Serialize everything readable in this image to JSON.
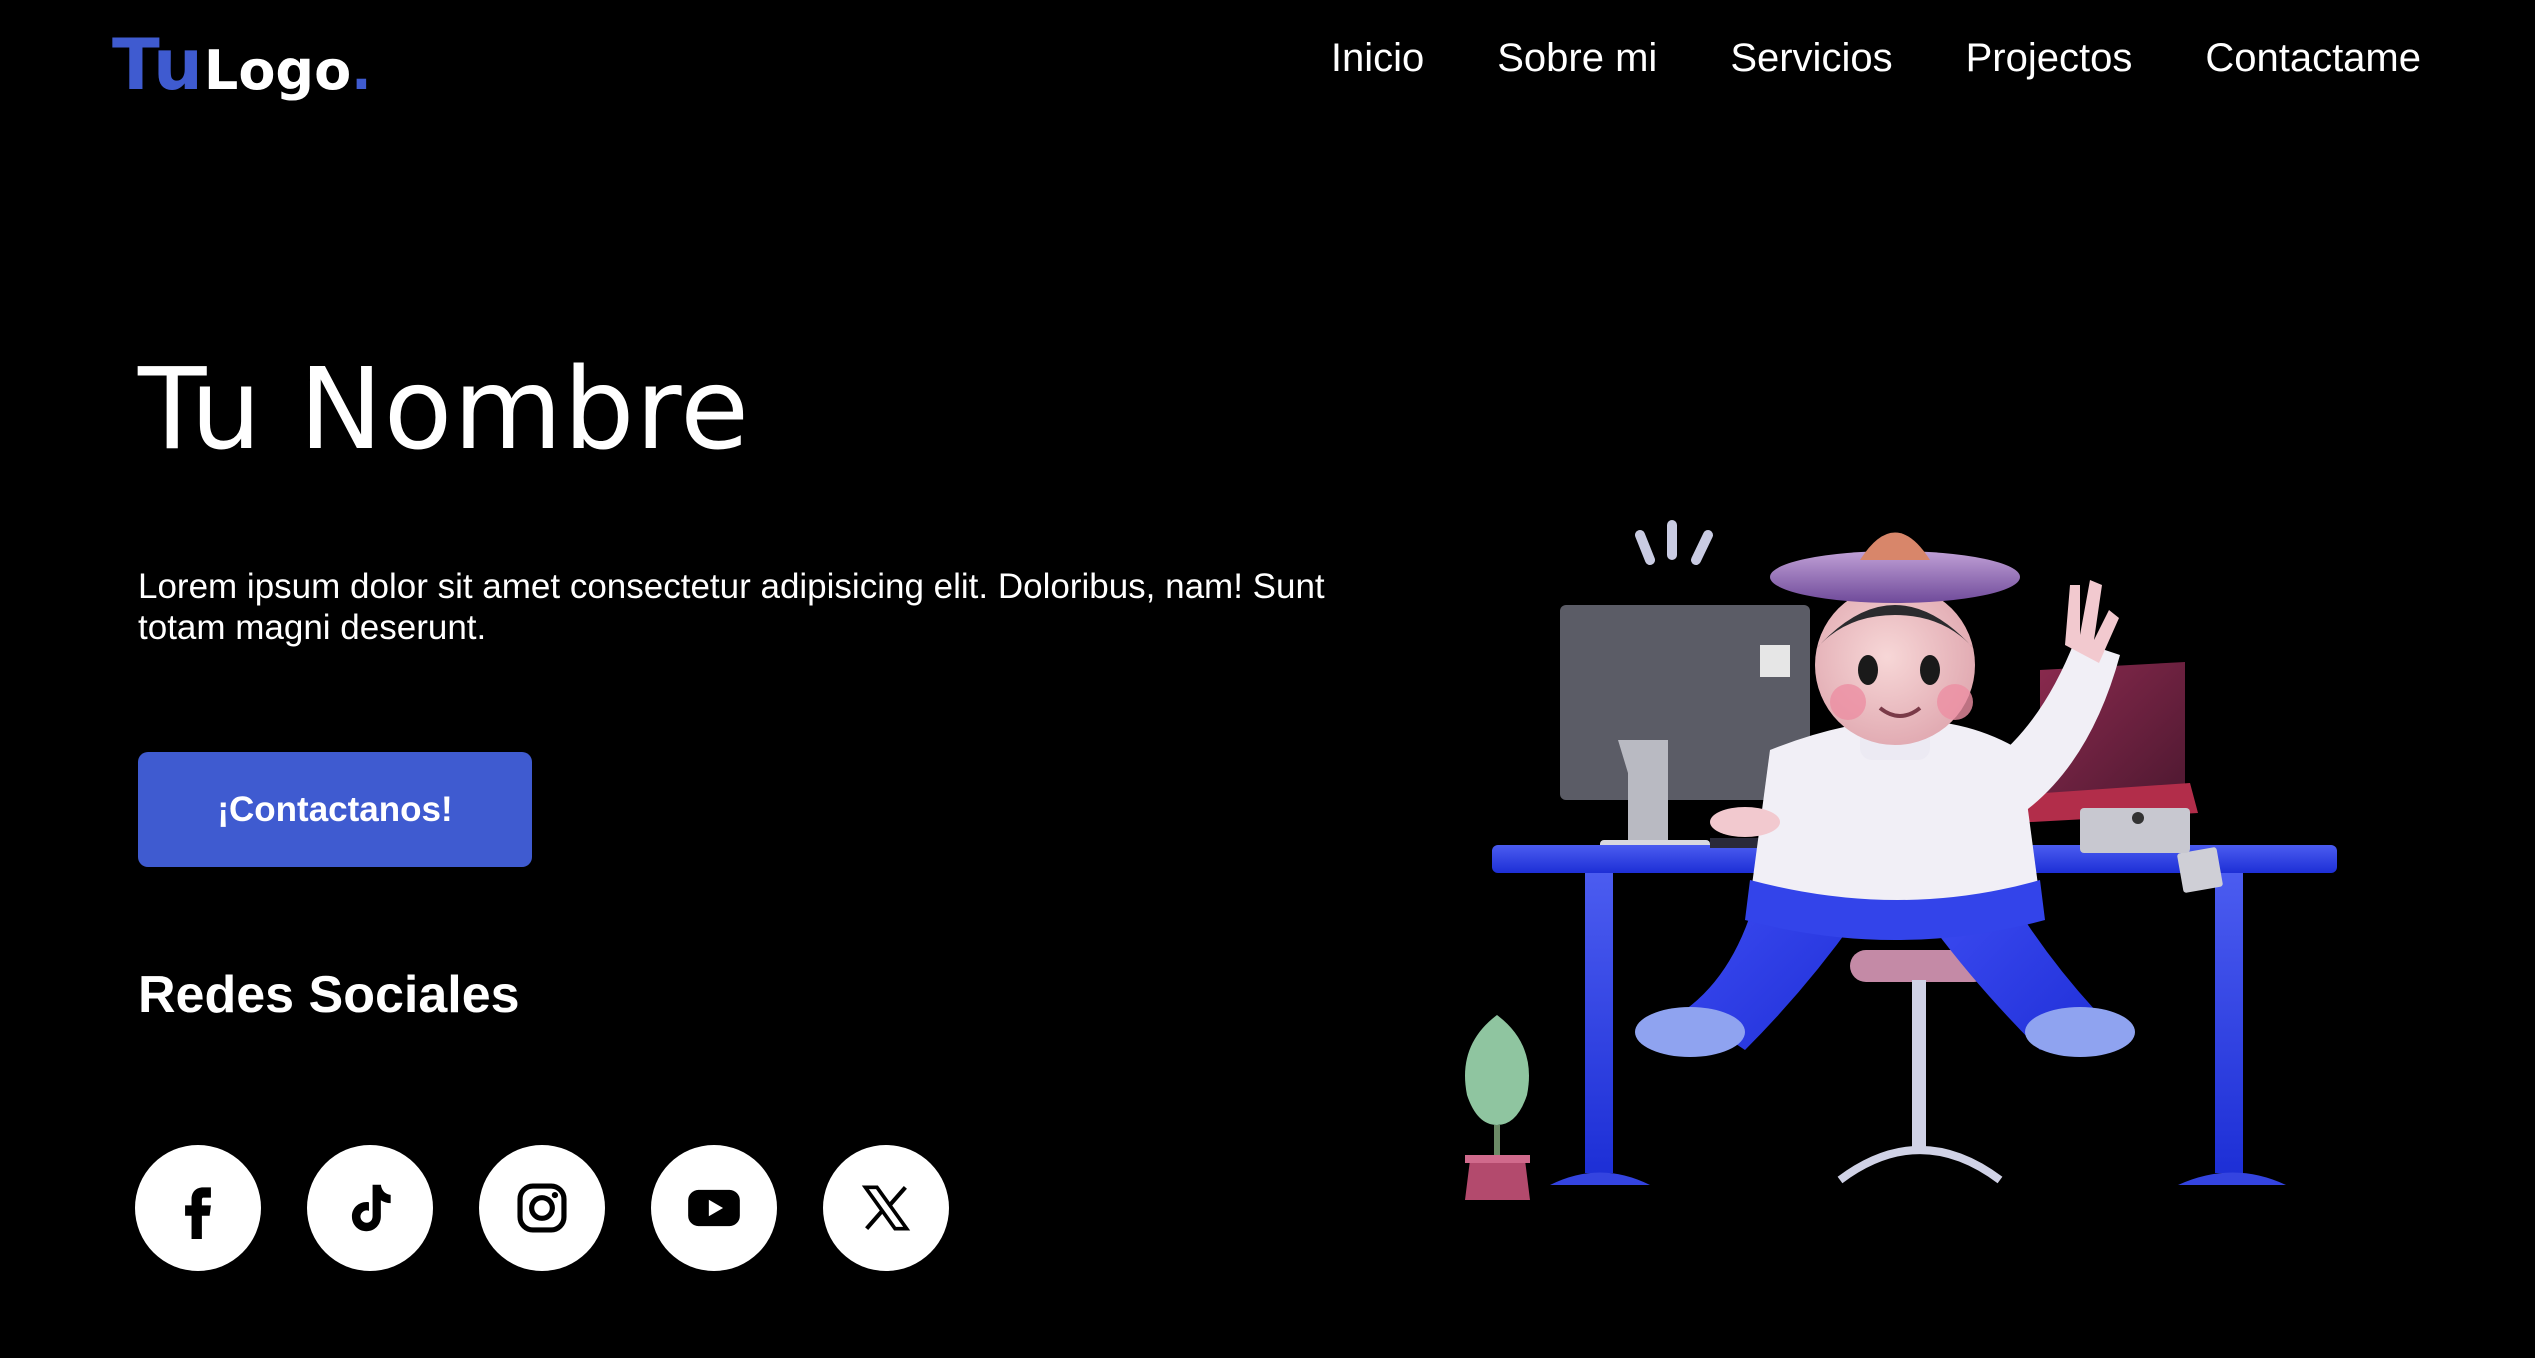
{
  "header": {
    "logo": {
      "tu": "Tu",
      "text": "Logo",
      "dot": "."
    },
    "nav": [
      "Inicio",
      "Sobre mi",
      "Servicios",
      "Projectos",
      "Contactame"
    ]
  },
  "hero": {
    "title": "Tu Nombre",
    "description": "Lorem ipsum dolor sit amet consectetur adipisicing elit. Doloribus, nam! Sunt totam magni deserunt.",
    "cta_label": "¡Contactanos!",
    "social_title": "Redes Sociales"
  },
  "socials": [
    {
      "icon": "facebook-icon"
    },
    {
      "icon": "tiktok-icon"
    },
    {
      "icon": "instagram-icon"
    },
    {
      "icon": "youtube-icon"
    },
    {
      "icon": "x-icon"
    }
  ],
  "colors": {
    "accent": "#3f5bd0",
    "background": "#000000",
    "text": "#ffffff"
  }
}
